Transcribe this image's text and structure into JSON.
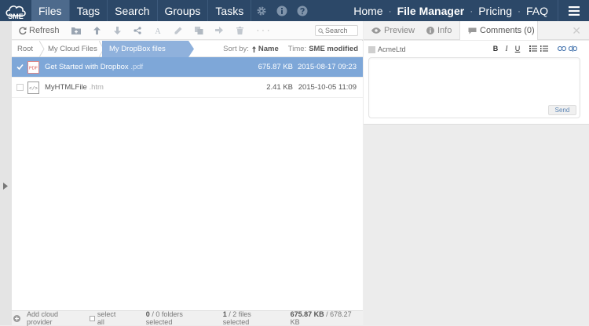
{
  "app": {
    "logo_text": "SME"
  },
  "nav": {
    "tabs": [
      {
        "label": "Files",
        "active": true
      },
      {
        "label": "Tags"
      },
      {
        "label": "Search"
      },
      {
        "label": "Groups"
      },
      {
        "label": "Tasks"
      }
    ],
    "icons": [
      "gear-icon",
      "info-icon",
      "help-icon"
    ],
    "right_links": [
      {
        "label": "Home"
      },
      {
        "label": "File Manager",
        "bold": true
      },
      {
        "label": "Pricing"
      },
      {
        "label": "FAQ"
      }
    ],
    "separator": "·"
  },
  "toolbar": {
    "refresh_label": "Refresh",
    "more_label": "· · ·",
    "search_placeholder": "Search"
  },
  "breadcrumb": {
    "items": [
      "Root",
      "My Cloud Files",
      "My DropBox files"
    ]
  },
  "sort": {
    "label": "Sort by:",
    "field": "Name",
    "time_label": "Time:",
    "time_value": "SME modified"
  },
  "files": [
    {
      "name": "Get Started with Dropbox",
      "ext": ".pdf",
      "size": "675.87 KB",
      "date": "2015-08-17 09:23",
      "selected": true,
      "icon": "pdf-file-icon"
    },
    {
      "name": "MyHTMLFile",
      "ext": ".htm",
      "size": "2.41 KB",
      "date": "2015-10-05 11:09",
      "selected": false,
      "icon": "html-file-icon"
    }
  ],
  "status": {
    "add_provider": "Add cloud provider",
    "select_all": "select all",
    "folders_count": "0",
    "folders_text": "/ 0 folders selected",
    "files_count": "1",
    "files_text": "/ 2 files selected",
    "size_selected": "675.87 KB",
    "size_total": "/ 678.27 KB"
  },
  "right_panel": {
    "tabs": [
      {
        "label": "Preview"
      },
      {
        "label": "Info"
      },
      {
        "label": "Comments (0)",
        "active": true
      }
    ],
    "close_label": "✕",
    "user": "AcmeLtd",
    "format_buttons": [
      "B",
      "I",
      "U"
    ],
    "send_label": "Send"
  },
  "colors": {
    "topbar": "#2c4868",
    "active_tab": "#4d6a8c",
    "selection": "#7ea7d8",
    "breadcrumb_active": "#8fb1dc"
  }
}
